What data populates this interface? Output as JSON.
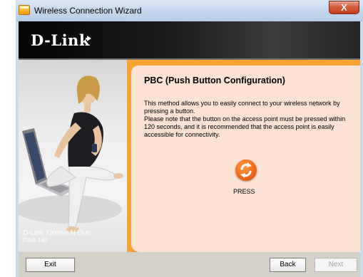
{
  "window": {
    "title": "Wireless Connection Wizard",
    "close_label": "X"
  },
  "header": {
    "logo": "D-Link"
  },
  "product": {
    "name": "D-Link Xtreme N Duo",
    "model": "DWA-160"
  },
  "main": {
    "heading": "PBC (Push Button Configuration)",
    "paragraph1": "This method allows you to easily connect to your wireless network by pressing a button.",
    "paragraph2": "Please note that the button on the access point must be pressed within 120 seconds, and it is recommended that the access point is easily accessible for connectivity.",
    "press_label": "PRESS"
  },
  "footer": {
    "exit_label": "Exit",
    "back_label": "Back",
    "next_label": "Next",
    "next_enabled": false
  },
  "colors": {
    "accent_orange": "#f7a234",
    "card_bg": "#fbe2d2",
    "banner_dark": "#111111"
  },
  "icons": {
    "press": "circular-arrows-icon",
    "title": "wizard-window-icon"
  }
}
